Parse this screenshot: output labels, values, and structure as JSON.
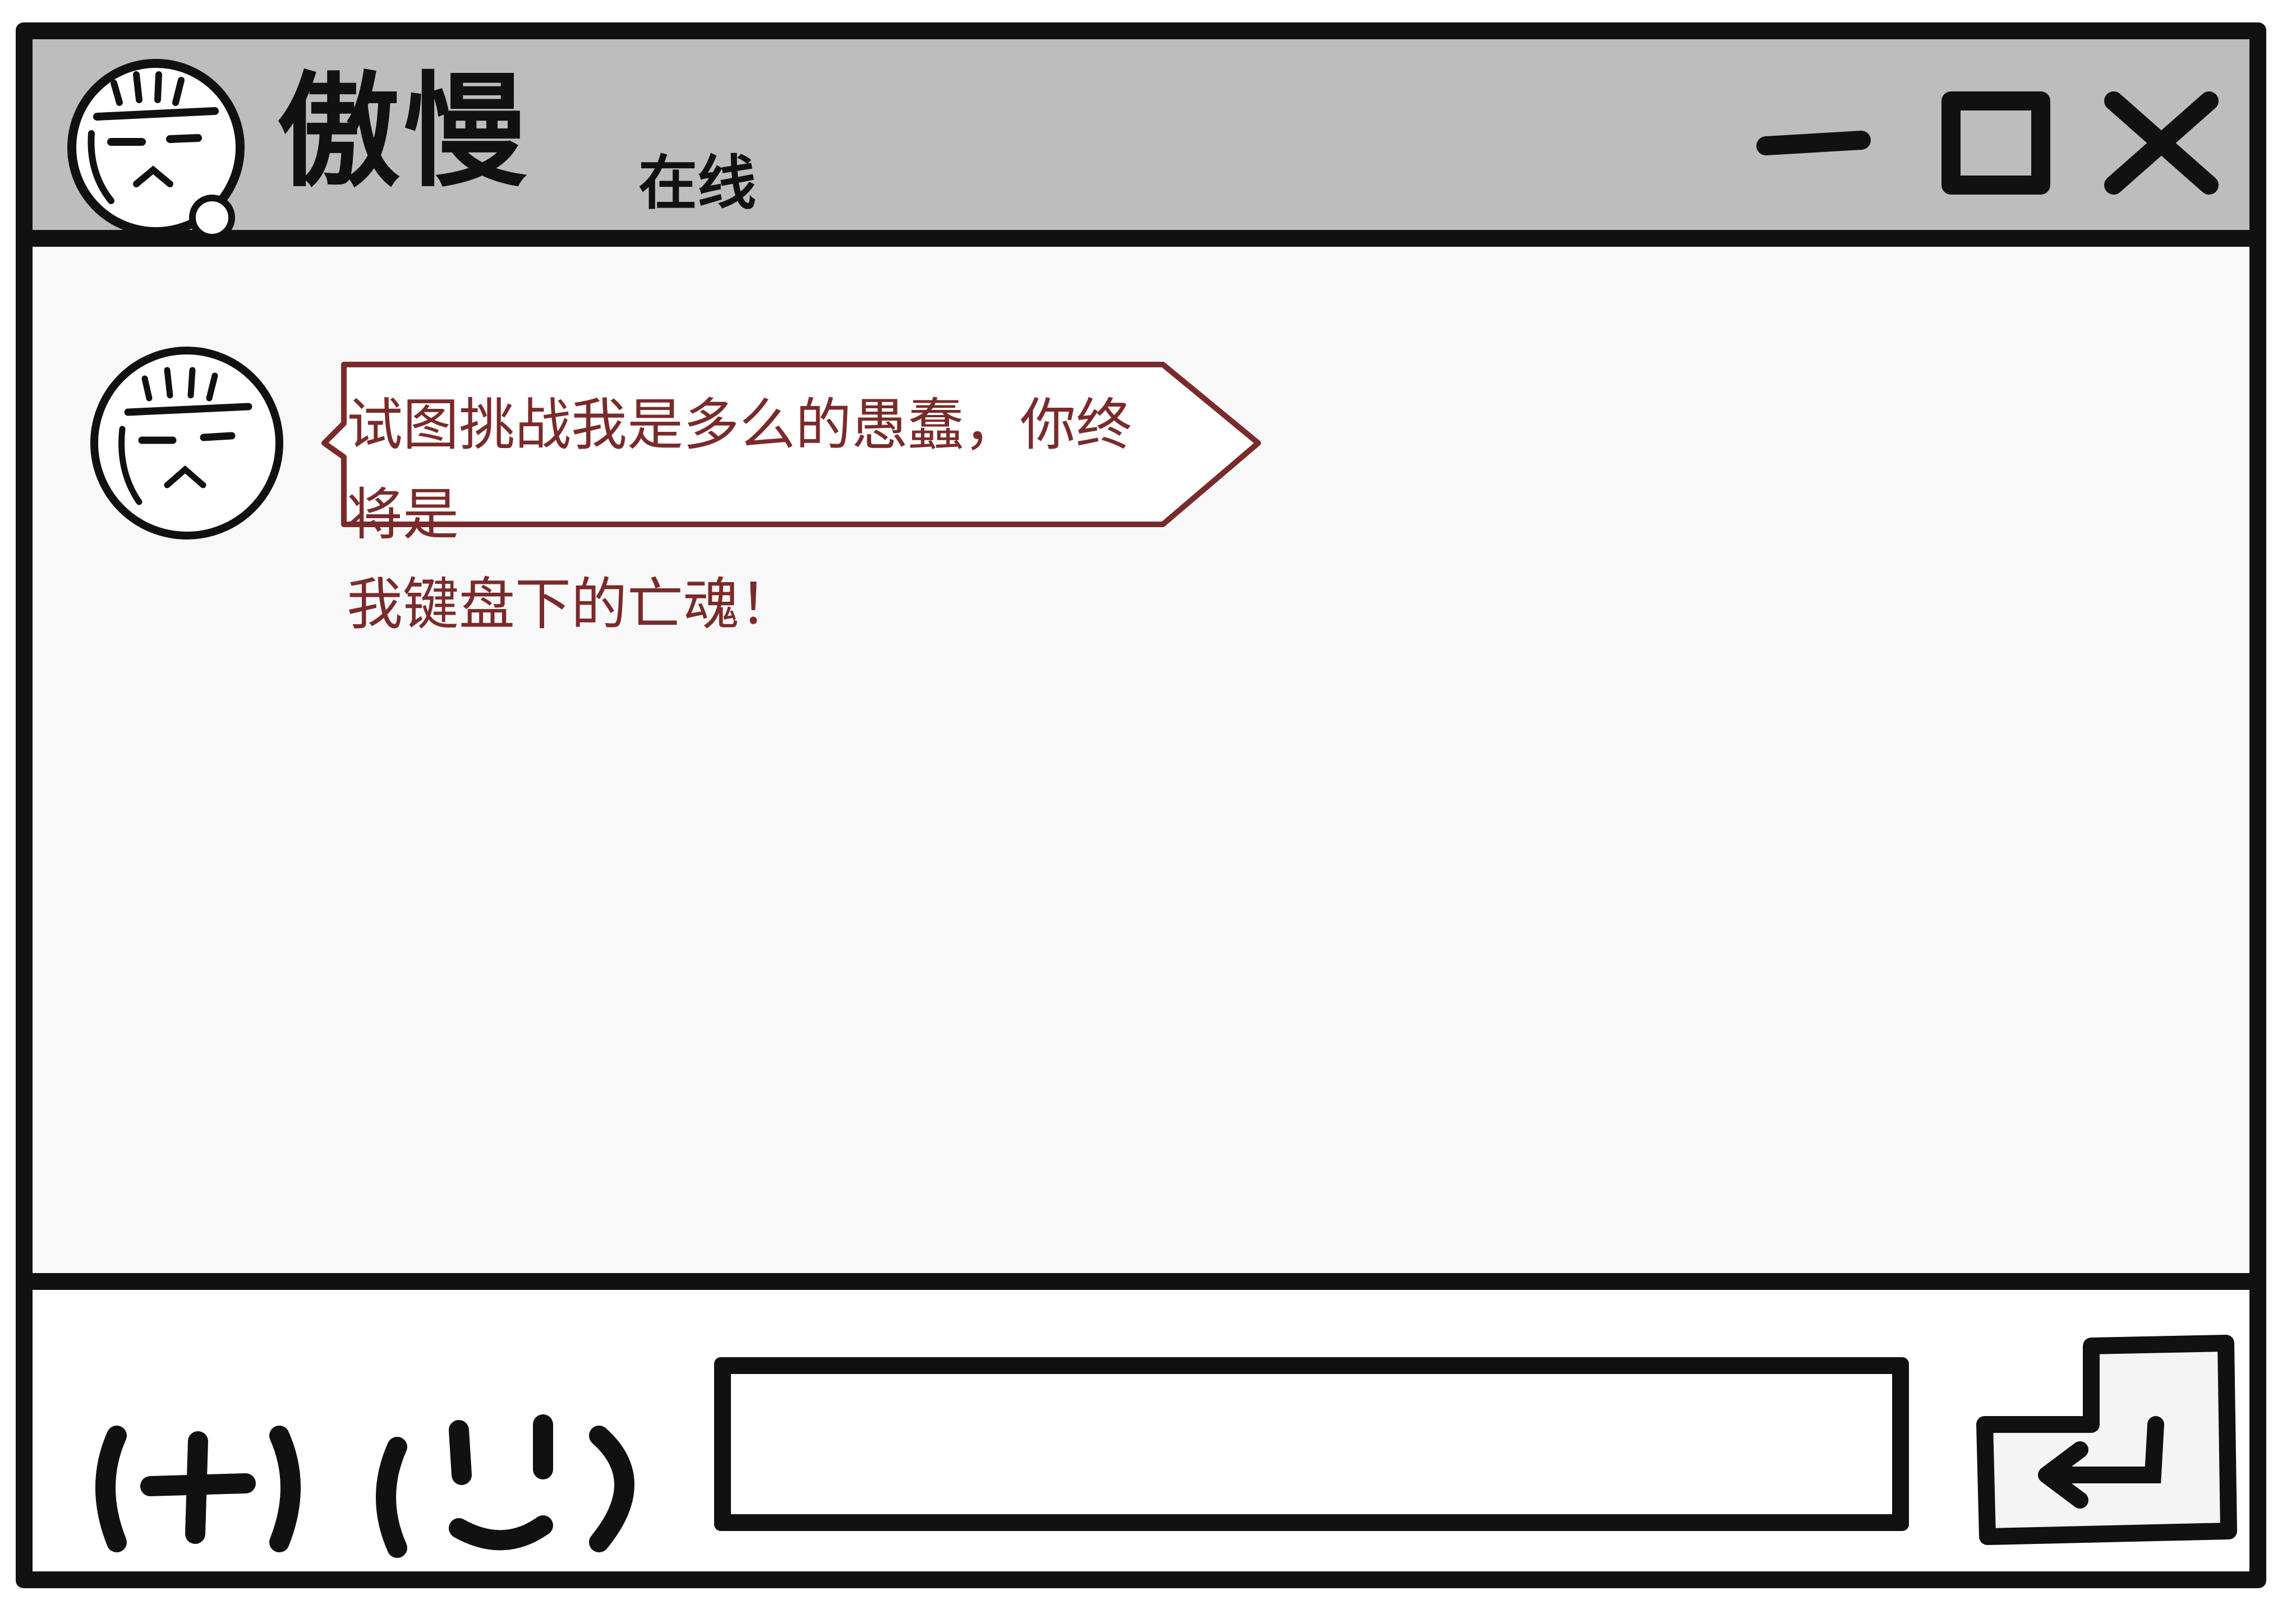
{
  "window": {
    "title": "傲慢",
    "status": "在线"
  },
  "controls": {
    "minimize_icon": "minimize-icon",
    "maximize_icon": "maximize-icon",
    "close_icon": "close-icon"
  },
  "messages": [
    {
      "sender_avatar": "grumpy-face-avatar",
      "text": "试图挑战我是多么的愚蠢，你终将是\n我键盘下的亡魂！",
      "bubble_color": "#7a2a2a"
    }
  ],
  "input": {
    "value": "",
    "placeholder": ""
  },
  "toolbar": {
    "add_icon": "plus-icon",
    "emoji_icon": "smiley-icon",
    "send_icon": "enter-arrow-icon"
  }
}
